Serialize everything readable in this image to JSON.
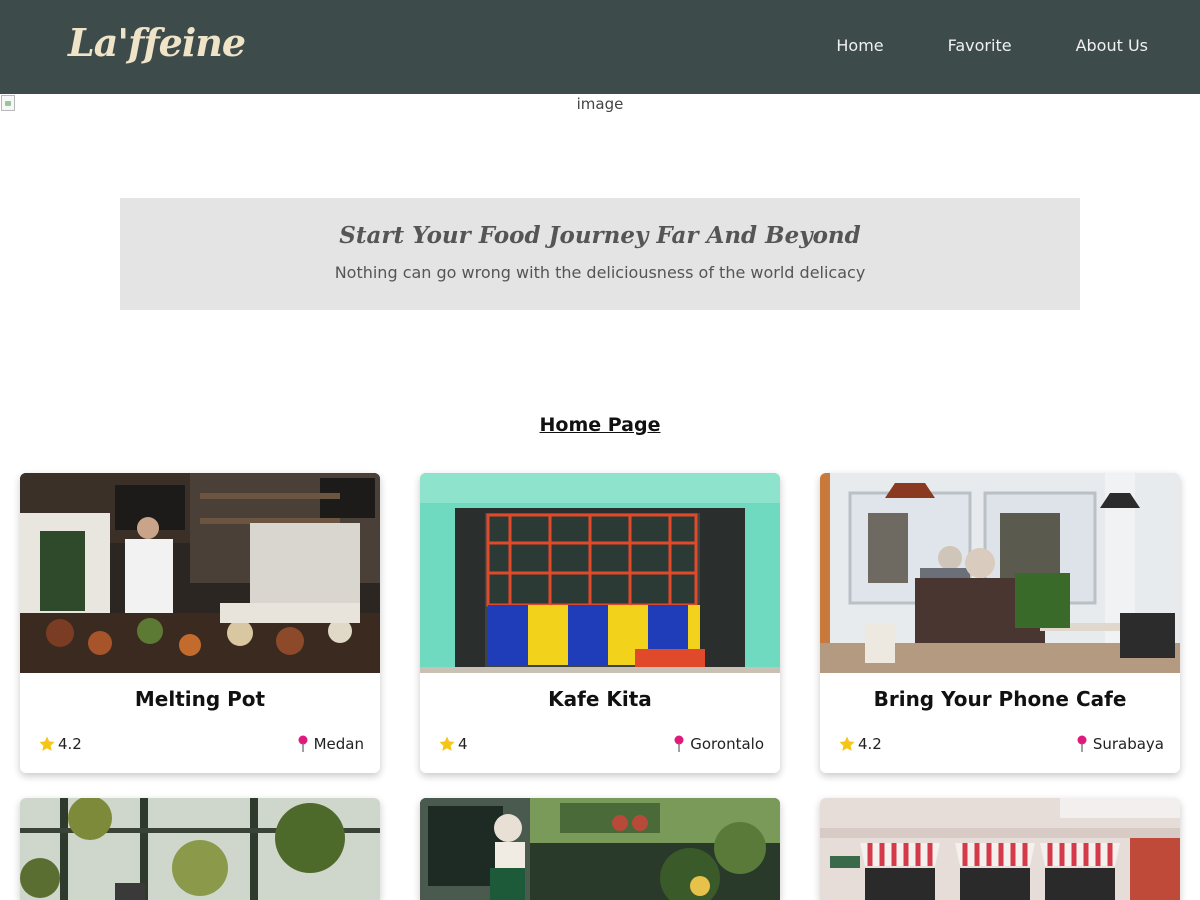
{
  "brand": {
    "logo": "La'ffeine"
  },
  "nav": {
    "items": [
      "Home",
      "Favorite",
      "About Us"
    ]
  },
  "hero": {
    "alt": "image"
  },
  "tagline": {
    "title": "Start Your Food Journey Far And Beyond",
    "subtitle": "Nothing can go wrong with the deliciousness of the world delicacy"
  },
  "page": {
    "heading": "Home Page"
  },
  "restaurants": [
    {
      "name": "Melting Pot",
      "rating": "4.2",
      "city": "Medan"
    },
    {
      "name": "Kafe Kita",
      "rating": "4",
      "city": "Gorontalo"
    },
    {
      "name": "Bring Your Phone Cafe",
      "rating": "4.2",
      "city": "Surabaya"
    }
  ],
  "colors": {
    "navbar": "#3e4b4b",
    "logo": "#efe3c8",
    "tagline_bg": "#e4e4e4",
    "star": "#f5c518",
    "pin": "#e0197d"
  }
}
